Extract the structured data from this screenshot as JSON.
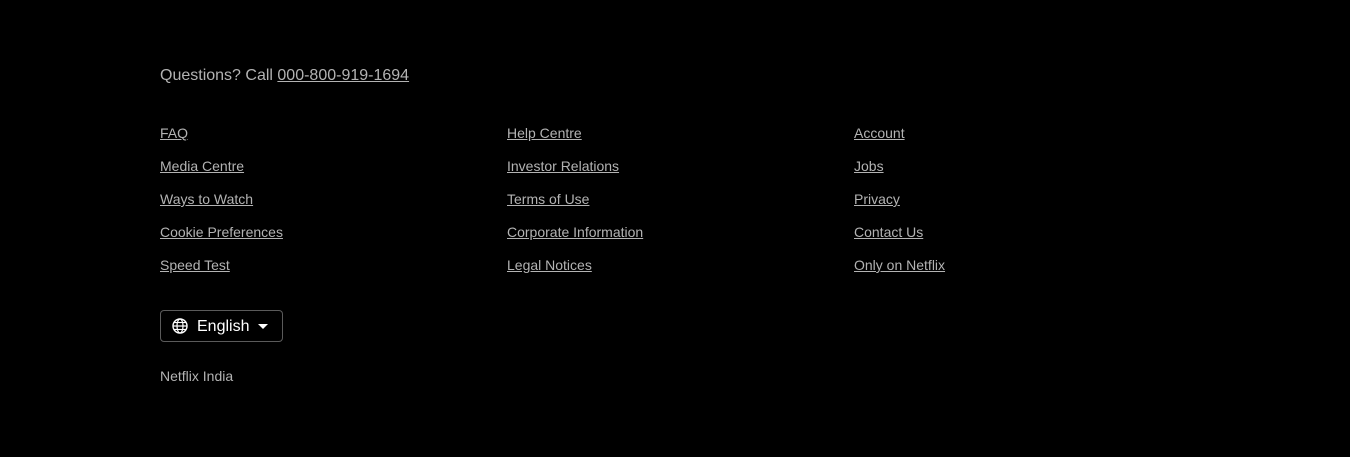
{
  "contact": {
    "prefix": "Questions? Call ",
    "phone": "000-800-919-1694"
  },
  "links": [
    {
      "label": "FAQ",
      "name": "link-faq"
    },
    {
      "label": "Help Centre",
      "name": "link-help-centre"
    },
    {
      "label": "Account",
      "name": "link-account"
    },
    {
      "label": "Media Centre",
      "name": "link-media-centre"
    },
    {
      "label": "Investor Relations",
      "name": "link-investor-relations"
    },
    {
      "label": "Jobs",
      "name": "link-jobs"
    },
    {
      "label": "Ways to Watch",
      "name": "link-ways-to-watch"
    },
    {
      "label": "Terms of Use",
      "name": "link-terms-of-use"
    },
    {
      "label": "Privacy",
      "name": "link-privacy"
    },
    {
      "label": "Cookie Preferences",
      "name": "link-cookie-preferences"
    },
    {
      "label": "Corporate Information",
      "name": "link-corporate-information"
    },
    {
      "label": "Contact Us",
      "name": "link-contact-us"
    },
    {
      "label": "Speed Test",
      "name": "link-speed-test"
    },
    {
      "label": "Legal Notices",
      "name": "link-legal-notices"
    },
    {
      "label": "Only on Netflix",
      "name": "link-only-on-netflix"
    }
  ],
  "language": {
    "selected": "English",
    "icon": "globe-icon",
    "dropdown_icon": "chevron-down-icon"
  },
  "country": "Netflix India",
  "colors": {
    "background": "#000000",
    "text": "#b3b3b3",
    "language_text": "#ffffff"
  }
}
